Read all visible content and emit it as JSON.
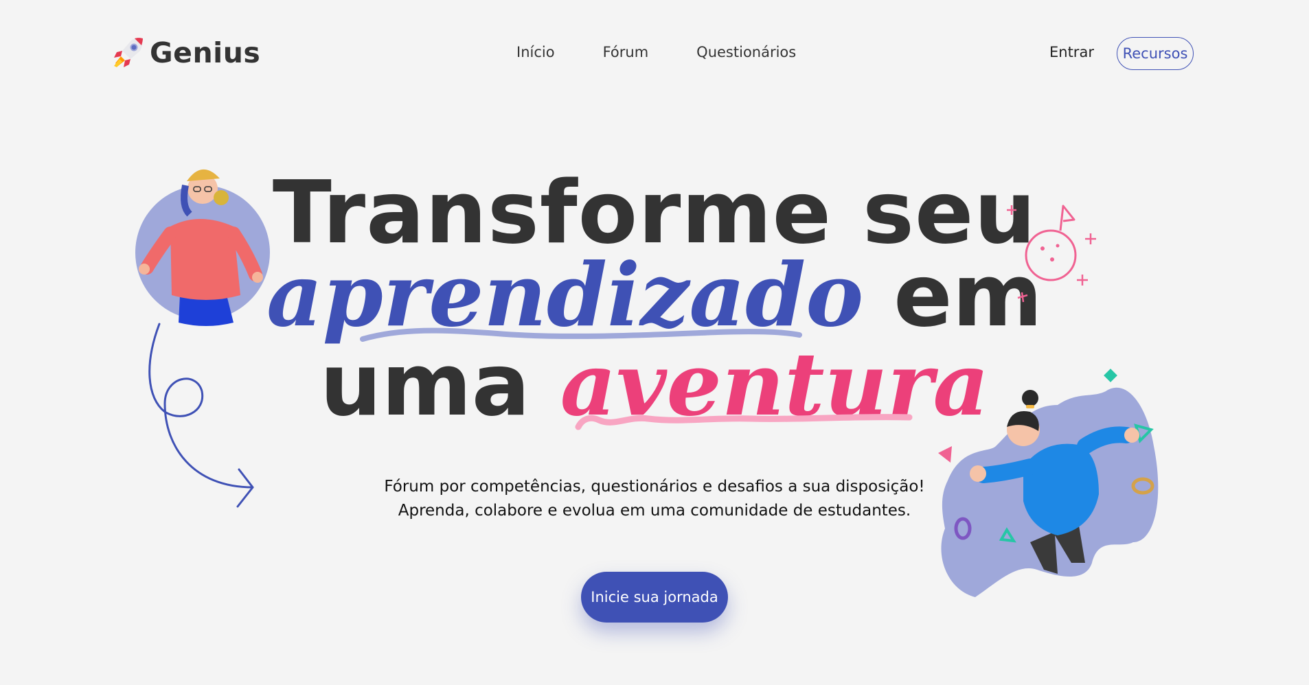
{
  "brand": {
    "name": "Genius"
  },
  "nav": {
    "items": [
      "Início",
      "Fórum",
      "Questionários"
    ],
    "signin": "Entrar",
    "resources": "Recursos"
  },
  "hero": {
    "line1": "Transforme seu",
    "line2_accent": "aprendizado",
    "line2_rest": "em",
    "line3_start": "uma",
    "line3_accent": "aventura",
    "subtitle_1": "Fórum por competências, questionários e desafios a sua disposição!",
    "subtitle_2": "Aprenda, colabore e evolua em uma comunidade de estudantes.",
    "cta": "Inicie sua jornada"
  },
  "colors": {
    "primary": "#3f51b5",
    "accent_pink": "#ec407a",
    "background": "#f4f4f4",
    "text": "#333333"
  },
  "icons": [
    "rocket-icon",
    "curly-arrow-icon",
    "moon-flag-icon"
  ]
}
